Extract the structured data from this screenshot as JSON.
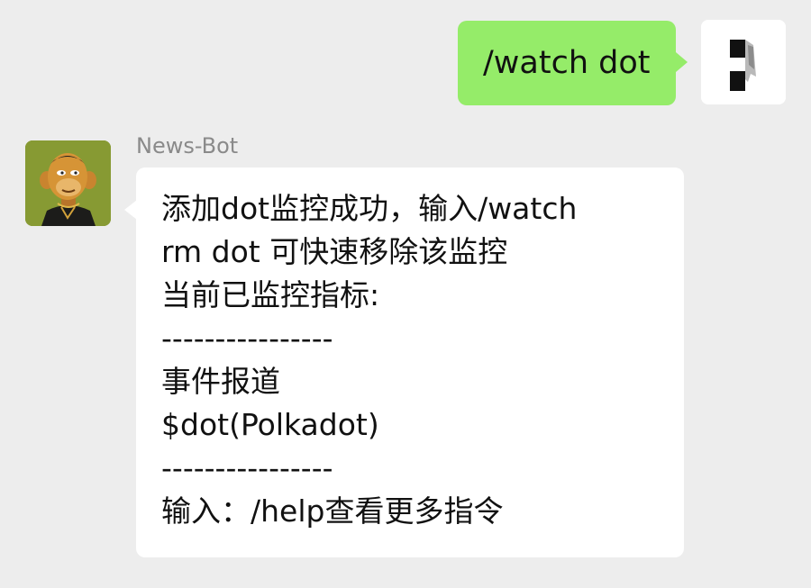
{
  "outgoing_message": {
    "text": "/watch dot",
    "avatar_icon": "user-avatar-icon",
    "bubble_color": "#95ec69"
  },
  "incoming_message": {
    "sender": "News-Bot",
    "avatar_icon": "ape-nft-avatar-icon",
    "lines": [
      "添加dot监控成功，输入/watch",
      "rm dot 可快速移除该监控",
      "当前已监控指标:",
      "----------------",
      "事件报道",
      "$dot(Polkadot)",
      "----------------",
      "输入：/help查看更多指令"
    ]
  },
  "colors": {
    "background": "#ededed",
    "incoming_bubble": "#ffffff",
    "sender_name": "#8a8a8a"
  }
}
